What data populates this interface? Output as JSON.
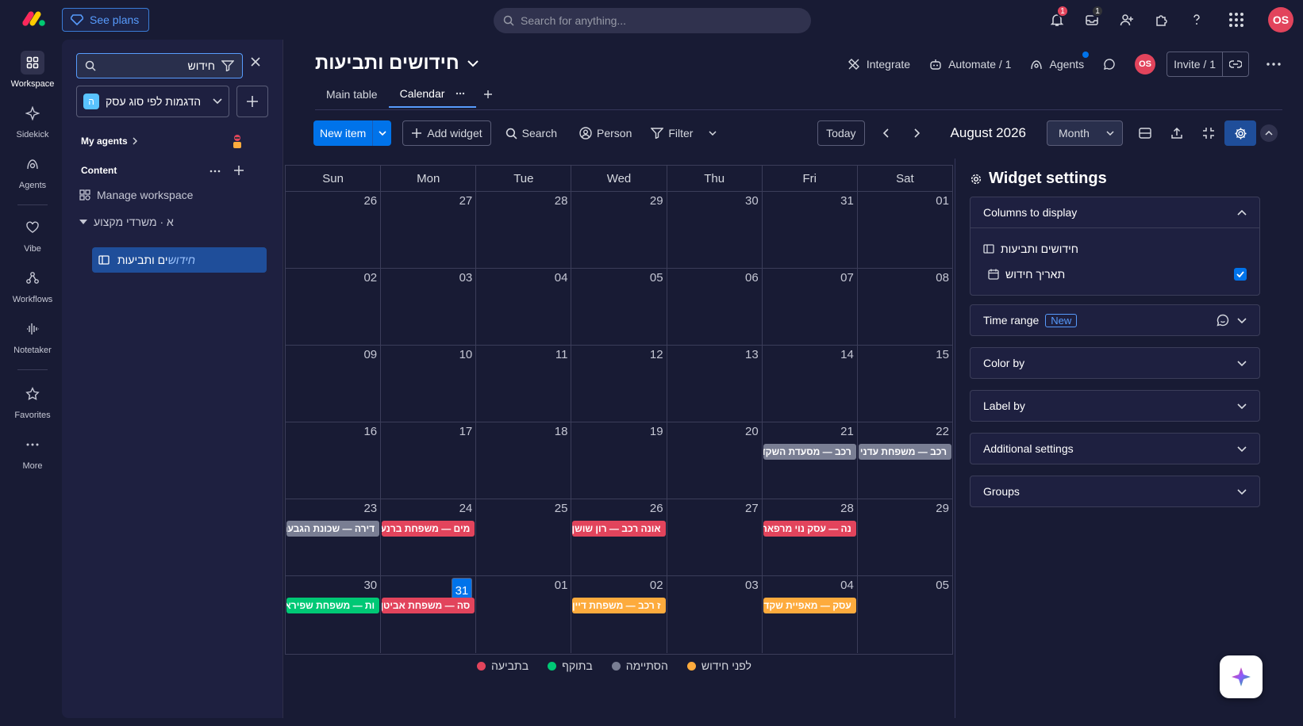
{
  "topbar": {
    "see_plans": "See plans",
    "search_placeholder": "Search for anything...",
    "notifications_count": "1",
    "inbox_count": "1",
    "avatar": "OS"
  },
  "rail": [
    {
      "label": "Workspace",
      "icon": "grid-icon"
    },
    {
      "label": "Sidekick",
      "icon": "sparkle-icon"
    },
    {
      "label": "Agents",
      "icon": "agent-icon"
    },
    {
      "label": "Vibe",
      "icon": "heart-icon"
    },
    {
      "label": "Workflows",
      "icon": "workflow-icon"
    },
    {
      "label": "Notetaker",
      "icon": "waveform-icon"
    },
    {
      "label": "Favorites",
      "icon": "star-icon"
    },
    {
      "label": "More",
      "icon": "dots-icon"
    }
  ],
  "sidebar": {
    "search_value": "חידוש",
    "workspace_select": "הדגמות לפי סוג עסק",
    "workspace_badge": "ה",
    "my_agents": "My agents",
    "content": "Content",
    "manage_workspace": "Manage workspace",
    "folder": "א · משרדי מקצוע",
    "board_prefix": "ים ותביעות",
    "board_highlight": "חידוש"
  },
  "board": {
    "title": "חידושים ותביעות",
    "integrate": "Integrate",
    "automate": "Automate / 1",
    "agents": "Agents",
    "avatar": "OS",
    "invite": "Invite / 1",
    "tabs": [
      "Main table",
      "Calendar"
    ]
  },
  "toolbar": {
    "new_item": "New item",
    "add_widget": "Add widget",
    "search": "Search",
    "person": "Person",
    "filter": "Filter",
    "today": "Today",
    "month_label": "August 2026",
    "view_select": "Month"
  },
  "calendar": {
    "weekdays": [
      "Sun",
      "Mon",
      "Tue",
      "Wed",
      "Thu",
      "Fri",
      "Sat"
    ],
    "weeks": [
      [
        {
          "d": "26"
        },
        {
          "d": "27"
        },
        {
          "d": "28"
        },
        {
          "d": "29"
        },
        {
          "d": "30"
        },
        {
          "d": "31"
        },
        {
          "d": "01"
        }
      ],
      [
        {
          "d": "02"
        },
        {
          "d": "03"
        },
        {
          "d": "04"
        },
        {
          "d": "05"
        },
        {
          "d": "06"
        },
        {
          "d": "07"
        },
        {
          "d": "08"
        }
      ],
      [
        {
          "d": "09"
        },
        {
          "d": "10"
        },
        {
          "d": "11"
        },
        {
          "d": "12"
        },
        {
          "d": "13"
        },
        {
          "d": "14"
        },
        {
          "d": "15"
        }
      ],
      [
        {
          "d": "16"
        },
        {
          "d": "17"
        },
        {
          "d": "18"
        },
        {
          "d": "19"
        },
        {
          "d": "20"
        },
        {
          "d": "21",
          "event": "רכב — מסעדת השקד",
          "color": "#797e93"
        },
        {
          "d": "22",
          "event": "רכב — משפחת עדני",
          "color": "#797e93"
        }
      ],
      [
        {
          "d": "23",
          "event": "דירה — שכונת הגבעה",
          "color": "#797e93"
        },
        {
          "d": "24",
          "event": "מים — משפחת ברנע",
          "color": "#e2445c"
        },
        {
          "d": "25"
        },
        {
          "d": "26",
          "event": "אונה רכב — רון שושן",
          "color": "#e2445c"
        },
        {
          "d": "27"
        },
        {
          "d": "28",
          "event": "נה — עסק נוי מרפאה",
          "color": "#e2445c"
        },
        {
          "d": "29"
        }
      ],
      [
        {
          "d": "30",
          "event": "ות — משפחת שפירא",
          "color": "#00c875"
        },
        {
          "d": "31",
          "today": true,
          "event": "סה — משפחת אביטן",
          "color": "#e2445c"
        },
        {
          "d": "01"
        },
        {
          "d": "02",
          "event": "ז רכב — משפחת דיין",
          "color": "#fdab3d"
        },
        {
          "d": "03"
        },
        {
          "d": "04",
          "event": "עסק — מאפיית שקד",
          "color": "#fdab3d"
        },
        {
          "d": "05"
        }
      ]
    ]
  },
  "legend": [
    {
      "label": "בתביעה",
      "color": "#e2445c"
    },
    {
      "label": "בתוקף",
      "color": "#00c875"
    },
    {
      "label": "הסתיימה",
      "color": "#797e93"
    },
    {
      "label": "לפני חידוש",
      "color": "#fdab3d"
    }
  ],
  "widget": {
    "title": "Widget settings",
    "columns_to_display": "Columns to display",
    "col1": "חידושים ותביעות",
    "col2": "תאריך חידוש",
    "time_range": "Time range",
    "new_tag": "New",
    "color_by": "Color by",
    "label_by": "Label by",
    "additional": "Additional settings",
    "groups": "Groups"
  }
}
